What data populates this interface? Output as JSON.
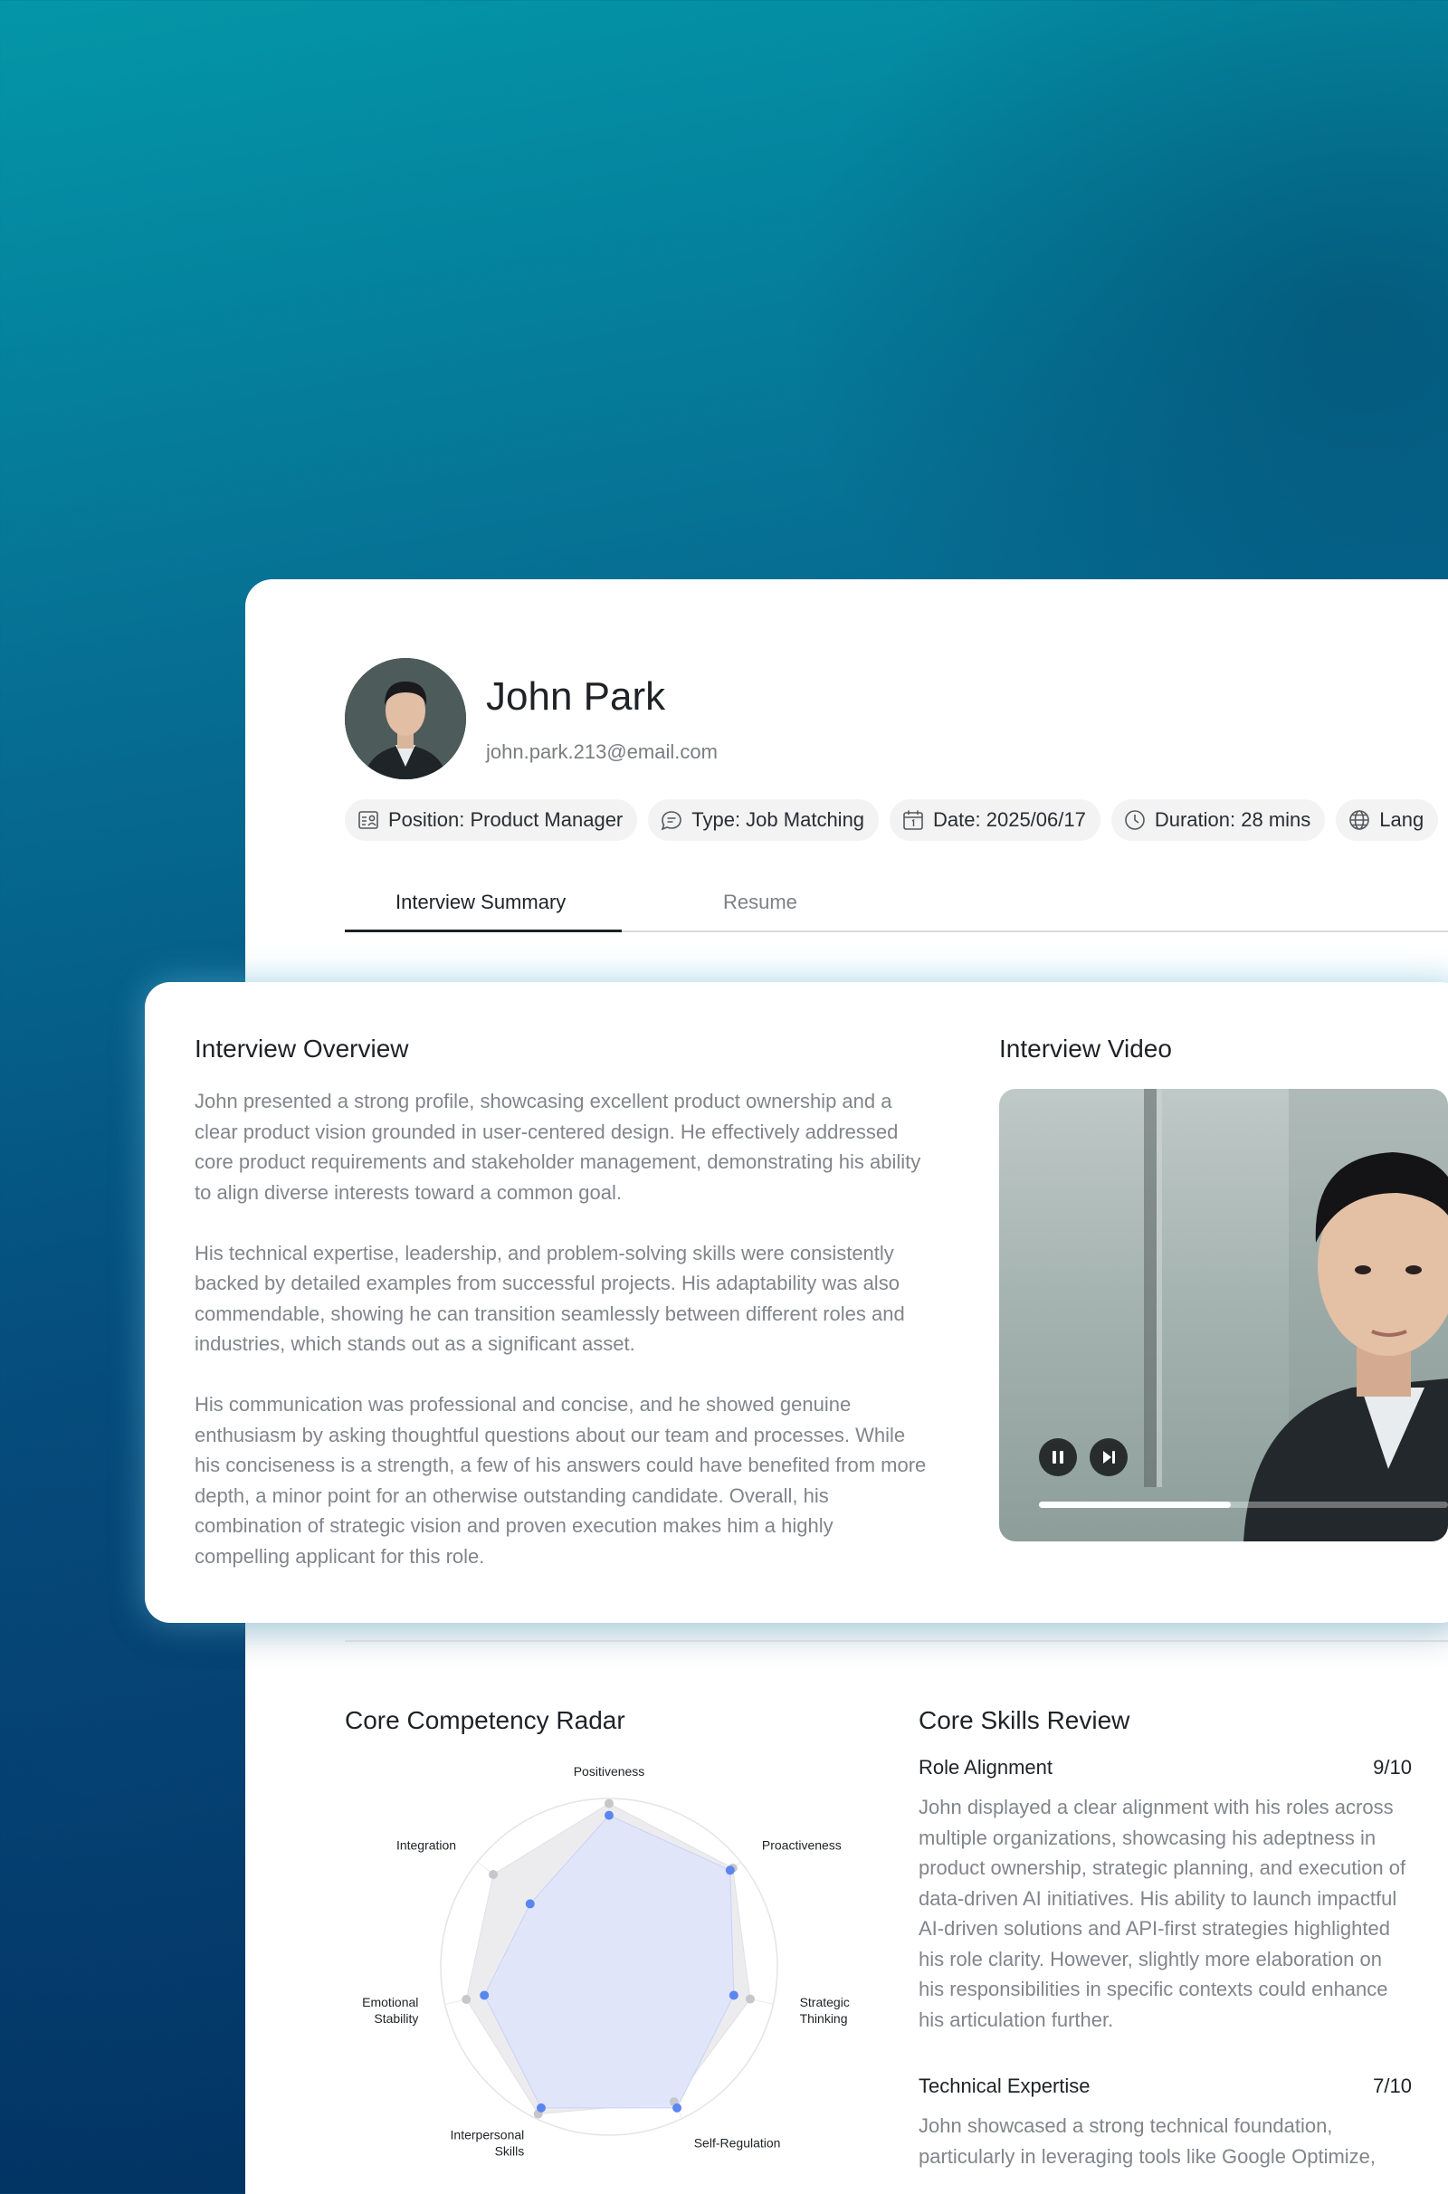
{
  "profile": {
    "name": "John Park",
    "email": "john.park.213@email.com",
    "chips": [
      {
        "icon": "position-icon",
        "text": "Position: Product Manager"
      },
      {
        "icon": "chat-icon",
        "text": "Type: Job Matching"
      },
      {
        "icon": "calendar-icon",
        "text": "Date: 2025/06/17"
      },
      {
        "icon": "clock-icon",
        "text": "Duration: 28 mins"
      },
      {
        "icon": "globe-icon",
        "text": "Lang"
      }
    ]
  },
  "tabs": {
    "summary": "Interview Summary",
    "resume": "Resume",
    "active": "summary"
  },
  "overview": {
    "title": "Interview Overview",
    "paragraphs": [
      "John presented a strong profile, showcasing excellent product ownership and a clear product vision grounded in user-centered design. He effectively addressed core product requirements and stakeholder management, demonstrating his ability to align diverse interests toward a common goal.",
      "His technical expertise, leadership, and problem-solving skills were consistently backed by detailed examples from successful projects. His adaptability was also commendable, showing he can transition seamlessly between different roles and industries, which stands out as a significant asset.",
      "His communication was professional and concise, and he showed genuine enthusiasm by asking thoughtful questions about our team and processes. While his conciseness is a strength, a few of his answers could have benefited from more depth, a minor point for an otherwise outstanding candidate. Overall, his combination of strategic vision and proven execution makes him a highly compelling applicant for this role."
    ]
  },
  "video": {
    "title": "Interview Video",
    "state": "playing",
    "progress": 0.47
  },
  "radar": {
    "title": "Core Competency Radar",
    "axes": [
      "Positiveness",
      "Proactiveness",
      "Strategic\nThinking",
      "Self-Regulation",
      "Interpersonal\nSkills",
      "Emotional\nStability",
      "Integration"
    ],
    "candidate": [
      0.9,
      0.92,
      0.76,
      0.93,
      0.93,
      0.76,
      0.6
    ],
    "benchmark": [
      0.97,
      0.94,
      0.86,
      0.89,
      0.97,
      0.87,
      0.88
    ],
    "colors": {
      "candidate": "#5b86f0",
      "candidate_fill": "#dfe4fb",
      "benchmark": "#c5c7cb",
      "benchmark_fill": "#ececef"
    }
  },
  "skills": {
    "title": "Core Skills Review",
    "items": [
      {
        "name": "Role Alignment",
        "score": "9/10",
        "text": "John displayed a clear alignment with his roles across multiple organizations, showcasing his adeptness in product ownership, strategic planning, and execution of data-driven AI initiatives. His ability to launch impactful AI-driven solutions and API-first strategies highlighted his role clarity. However, slightly more elaboration on his responsibilities in specific contexts could enhance his articulation further."
      },
      {
        "name": "Technical Expertise",
        "score": "7/10",
        "text": "John showcased a strong technical foundation, particularly in leveraging tools like Google Optimize,"
      }
    ]
  }
}
